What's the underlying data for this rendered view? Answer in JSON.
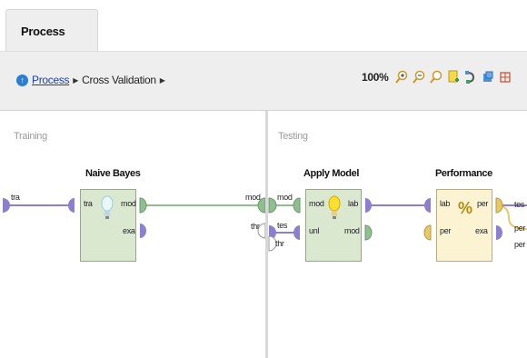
{
  "tab": {
    "label": "Process"
  },
  "breadcrumb": {
    "link": "Process",
    "current": "Cross Validation"
  },
  "toolbar": {
    "zoom": "100%",
    "icons": [
      "zoom-in-icon",
      "zoom-out-icon",
      "zoom-fit-icon",
      "add-note-icon",
      "auto-wire-icon",
      "layout-icon",
      "grid-icon"
    ]
  },
  "training": {
    "label": "Training",
    "input_port": "tra",
    "output_ports": [
      "mod"
    ],
    "operator": {
      "title": "Naive Bayes",
      "in_ports": [
        "tra"
      ],
      "out_ports": [
        "mod",
        "exa"
      ],
      "icon": "lightbulb-icon"
    }
  },
  "testing": {
    "label": "Testing",
    "input_ports": [
      "mod",
      "tes",
      "thr"
    ],
    "output_ports": [
      "tes",
      "per",
      "per"
    ],
    "apply_model": {
      "title": "Apply Model",
      "in_ports": [
        "mod",
        "unl"
      ],
      "out_ports": [
        "lab",
        "mod"
      ],
      "icon": "lightbulb-icon"
    },
    "performance": {
      "title": "Performance",
      "in_ports": [
        "lab",
        "per"
      ],
      "out_ports": [
        "per",
        "exa"
      ],
      "icon": "percent-icon"
    }
  },
  "left_outputs": [
    "mod",
    "thr"
  ],
  "colors": {
    "wire_model": "#8fbf8f",
    "wire_data": "#8a7fd0",
    "wire_perf": "#e8c96a",
    "op_green": "#d9e8cf",
    "op_yellow": "#fcf3d2"
  }
}
